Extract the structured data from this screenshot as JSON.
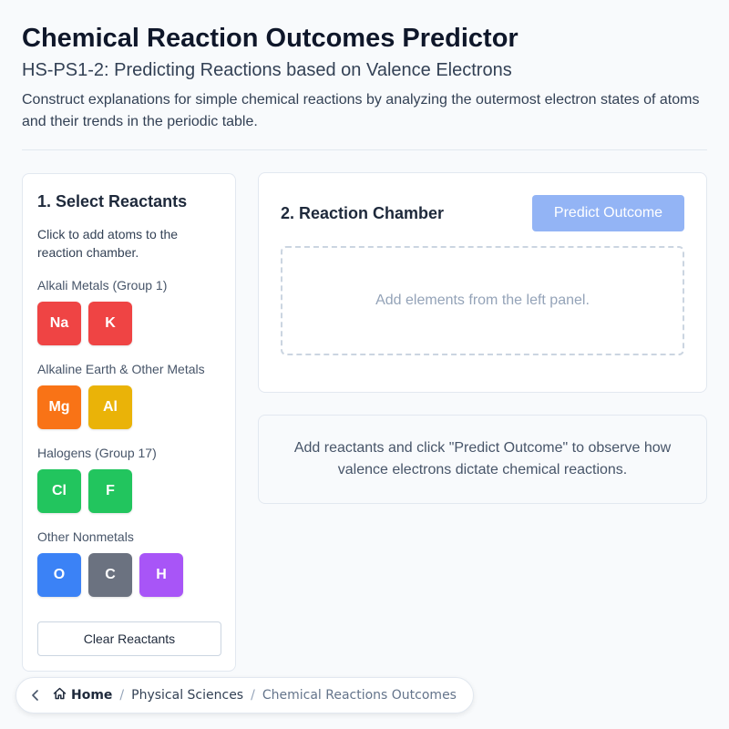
{
  "header": {
    "title": "Chemical Reaction Outcomes Predictor",
    "subtitle": "HS-PS1-2: Predicting Reactions based on Valence Electrons",
    "description": "Construct explanations for simple chemical reactions by analyzing the outermost electron states of atoms and their trends in the periodic table."
  },
  "reactants_panel": {
    "title": "1. Select Reactants",
    "instructions": "Click to add atoms to the reaction chamber.",
    "groups": [
      {
        "label": "Alkali Metals (Group 1)",
        "elements": [
          {
            "symbol": "Na",
            "color": "#ef4444"
          },
          {
            "symbol": "K",
            "color": "#ef4444"
          }
        ]
      },
      {
        "label": "Alkaline Earth & Other Metals",
        "elements": [
          {
            "symbol": "Mg",
            "color": "#f97316"
          },
          {
            "symbol": "Al",
            "color": "#eab308"
          }
        ]
      },
      {
        "label": "Halogens (Group 17)",
        "elements": [
          {
            "symbol": "Cl",
            "color": "#22c55e"
          },
          {
            "symbol": "F",
            "color": "#22c55e"
          }
        ]
      },
      {
        "label": "Other Nonmetals",
        "elements": [
          {
            "symbol": "O",
            "color": "#3b82f6"
          },
          {
            "symbol": "C",
            "color": "#6b7280"
          },
          {
            "symbol": "H",
            "color": "#a855f7"
          }
        ]
      }
    ],
    "clear_label": "Clear Reactants"
  },
  "chamber": {
    "title": "2. Reaction Chamber",
    "predict_label": "Predict Outcome",
    "dropzone_text": "Add elements from the left panel."
  },
  "result": {
    "message": "Add reactants and click \"Predict Outcome\" to observe how valence electrons dictate chemical reactions."
  },
  "breadcrumb": {
    "home": "Home",
    "section": "Physical Sciences",
    "current": "Chemical Reactions Outcomes"
  }
}
